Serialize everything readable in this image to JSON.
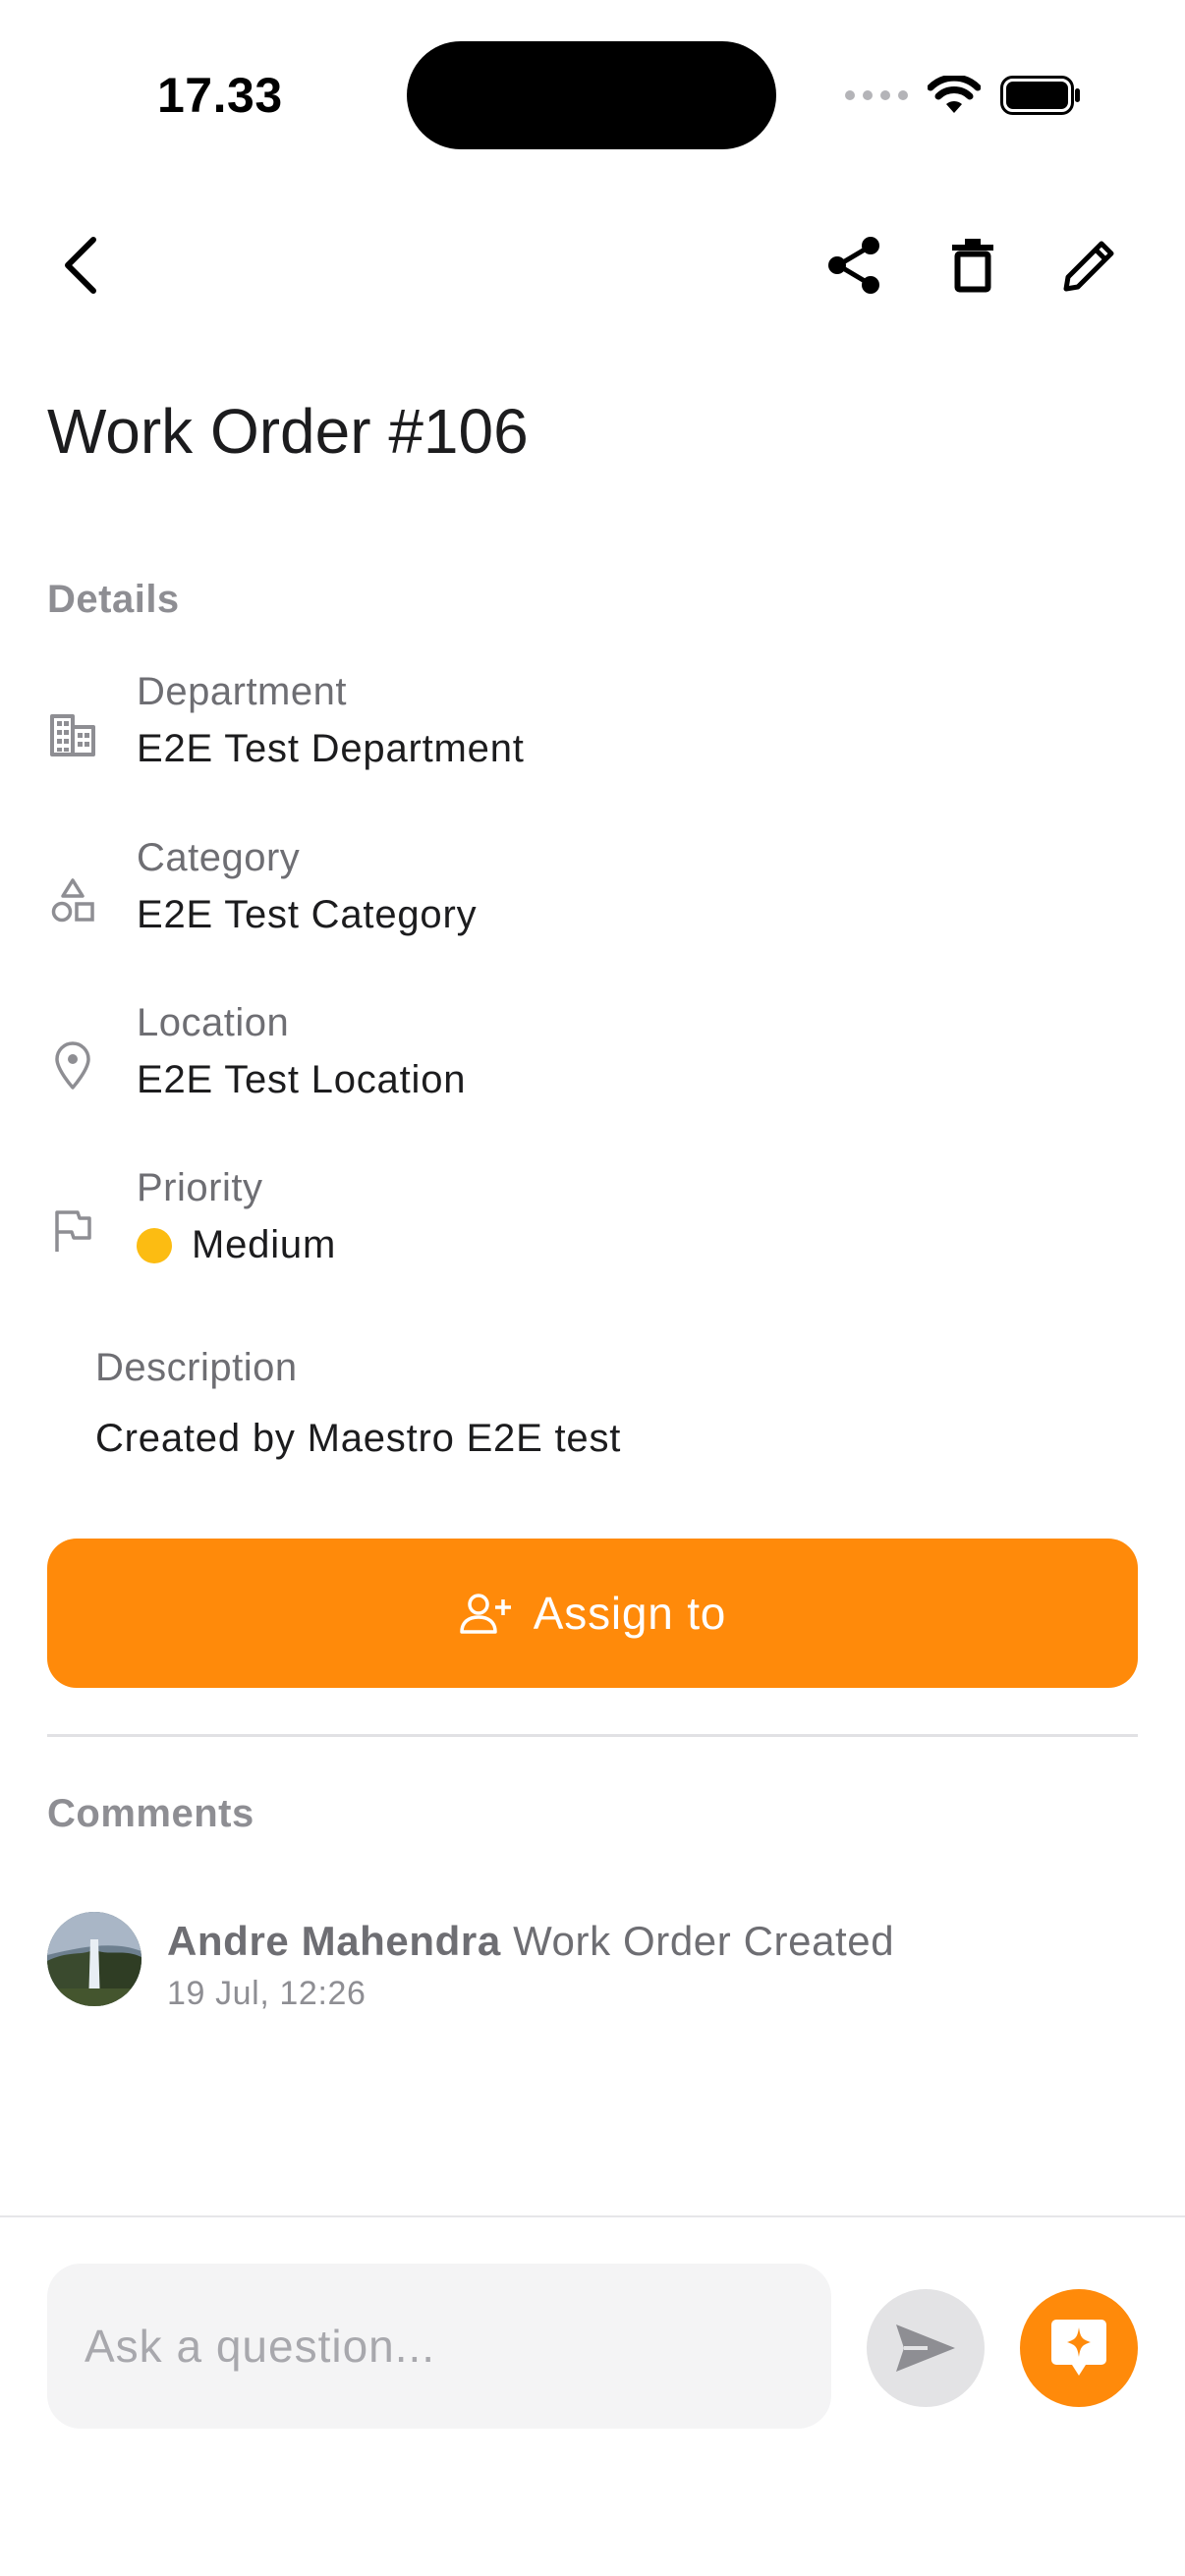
{
  "status_bar": {
    "time": "17.33",
    "icons": [
      "signal-dots-icon",
      "wifi-icon",
      "battery-icon"
    ]
  },
  "toolbar": {
    "icons": [
      "back-icon",
      "share-icon",
      "trash-icon",
      "pencil-icon"
    ]
  },
  "page": {
    "title": "Work Order #106"
  },
  "details": {
    "section_label": "Details",
    "items": [
      {
        "label": "Department",
        "value": "E2E Test Department",
        "icon": "building-icon"
      },
      {
        "label": "Category",
        "value": "E2E Test Category",
        "icon": "shapes-icon"
      },
      {
        "label": "Location",
        "value": "E2E Test Location",
        "icon": "map-pin-icon"
      },
      {
        "label": "Priority",
        "value": "Medium",
        "icon": "flag-icon",
        "status_color": "#fcbc12"
      }
    ]
  },
  "description": {
    "label": "Description",
    "value": "Created by Maestro E2E test"
  },
  "assign": {
    "label": "Assign to",
    "icon": "user-plus-icon",
    "color": "#ff8a0a"
  },
  "comments": {
    "section_label": "Comments",
    "items": [
      {
        "author": "Andre Mahendra",
        "text": "Work Order Created",
        "time": "19 Jul, 12:26"
      }
    ]
  },
  "composer": {
    "placeholder": "Ask a question...",
    "send_icon": "send-icon",
    "ai_icon": "sparkle-chat-icon"
  }
}
